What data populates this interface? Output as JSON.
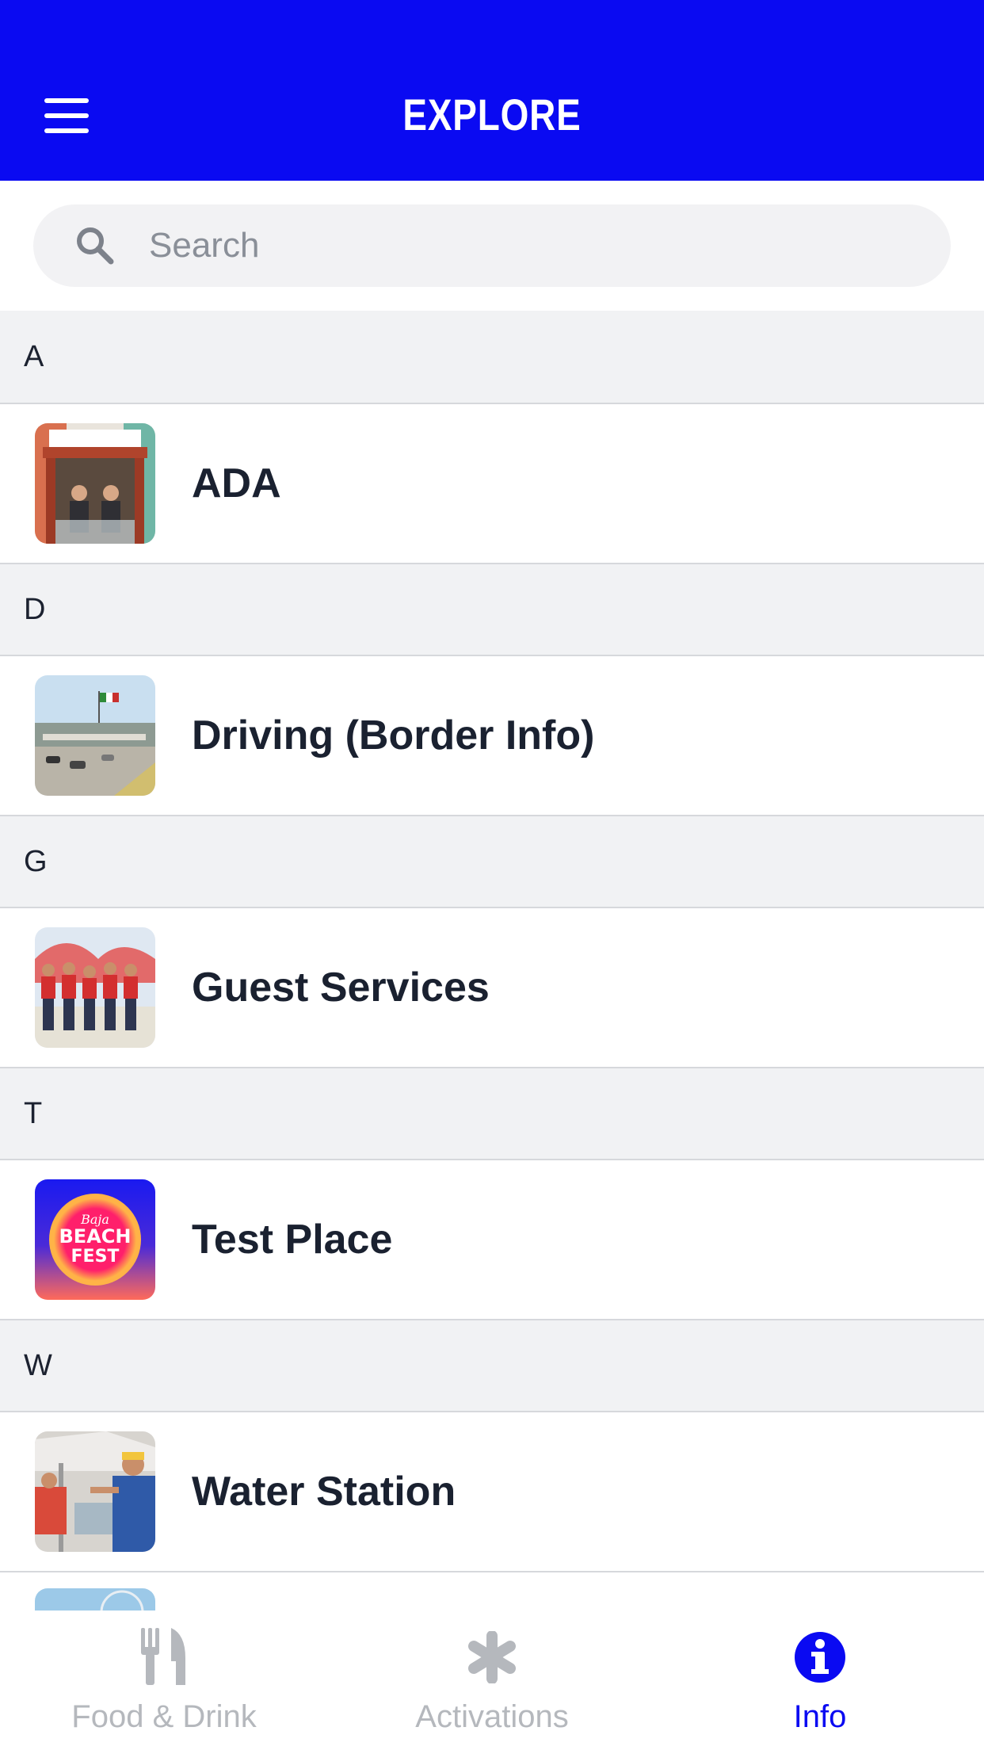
{
  "header": {
    "title": "EXPLORE",
    "menu_icon": "hamburger-menu-icon",
    "background": "#0a0af2"
  },
  "search": {
    "placeholder": "Search",
    "value": "",
    "icon": "search-icon"
  },
  "sections": [
    {
      "letter": "A",
      "items": [
        {
          "label": "ADA",
          "thumb": "ada-photo"
        }
      ]
    },
    {
      "letter": "D",
      "items": [
        {
          "label": "Driving (Border Info)",
          "thumb": "border-photo"
        }
      ]
    },
    {
      "letter": "G",
      "items": [
        {
          "label": "Guest Services",
          "thumb": "guest-services-photo"
        }
      ]
    },
    {
      "letter": "T",
      "items": [
        {
          "label": "Test Place",
          "thumb": "baja-beach-fest-logo"
        }
      ]
    },
    {
      "letter": "W",
      "items": [
        {
          "label": "Water Station",
          "thumb": "water-station-photo"
        }
      ]
    }
  ],
  "tabbar": {
    "tabs": [
      {
        "label": "Food & Drink",
        "icon": "fork-knife-icon",
        "active": false
      },
      {
        "label": "Activations",
        "icon": "asterisk-icon",
        "active": false
      },
      {
        "label": "Info",
        "icon": "info-icon",
        "active": true
      }
    ],
    "active_color": "#0a0af2",
    "inactive_color": "#b5b8bd"
  },
  "logo_text": {
    "line1": "Baja",
    "line2": "BEACH",
    "line3": "FEST"
  }
}
